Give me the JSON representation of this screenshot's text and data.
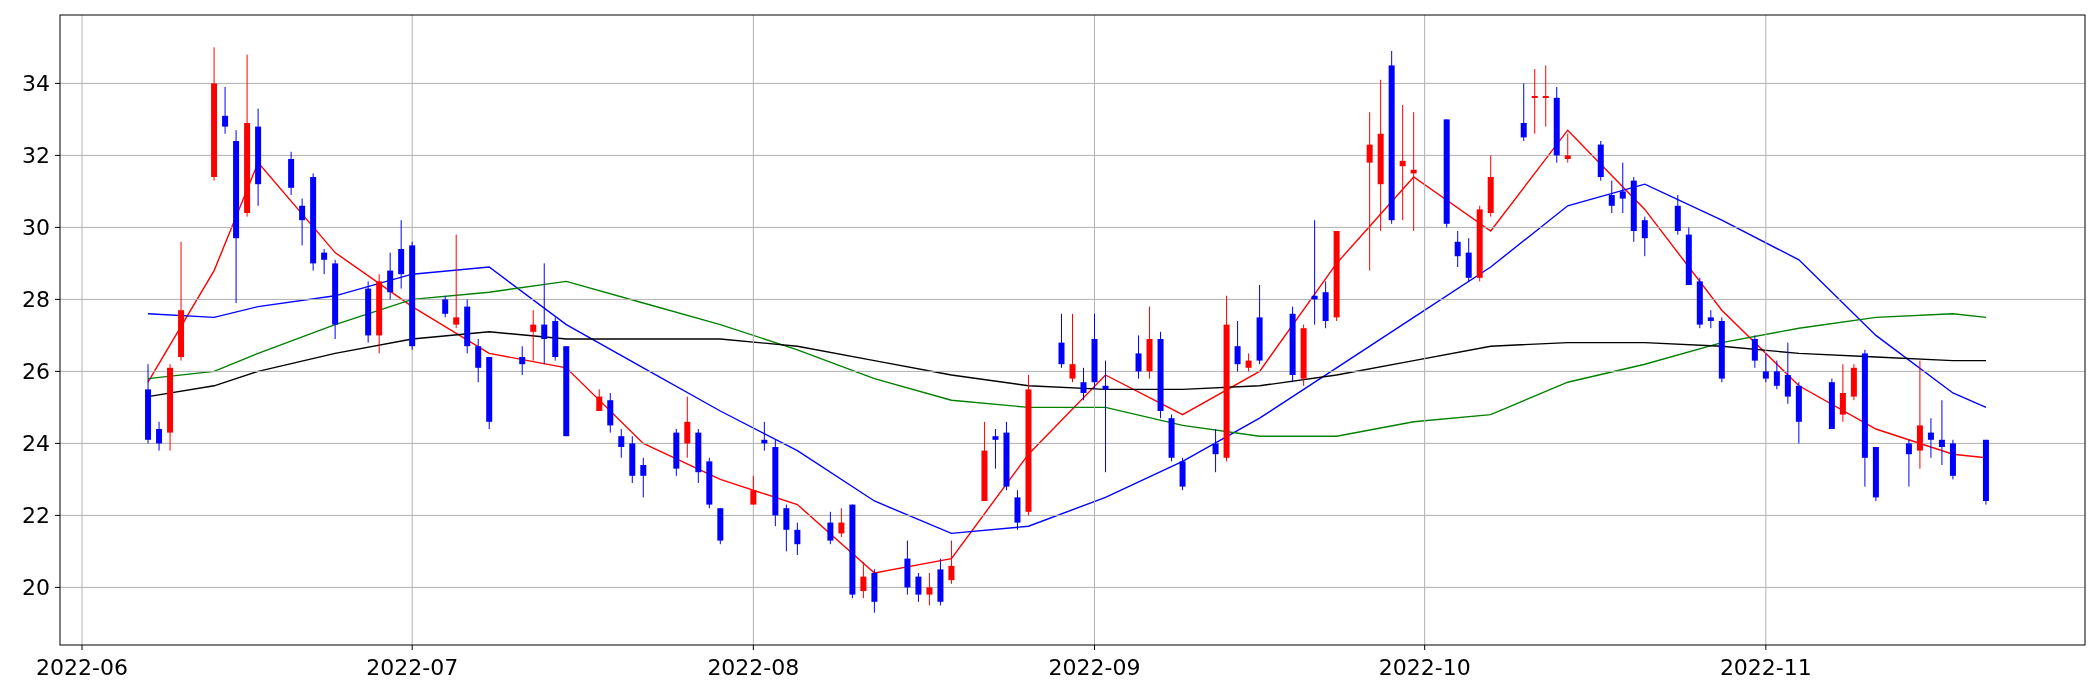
{
  "price_chart": {
    "chart_data": {
      "type": "candlestick",
      "grid": true,
      "xlim": [
        "2022-05-30",
        "2022-11-30"
      ],
      "ylim": [
        18.4,
        35.9
      ],
      "xticks": [
        {
          "value": "2022-06-01",
          "label": "2022-06"
        },
        {
          "value": "2022-07-01",
          "label": "2022-07"
        },
        {
          "value": "2022-08-01",
          "label": "2022-08"
        },
        {
          "value": "2022-09-01",
          "label": "2022-09"
        },
        {
          "value": "2022-10-01",
          "label": "2022-10"
        },
        {
          "value": "2022-11-01",
          "label": "2022-11"
        }
      ],
      "yticks": [
        20,
        22,
        24,
        26,
        28,
        30,
        32,
        34
      ],
      "x": [
        "2022-06-07",
        "2022-06-08",
        "2022-06-09",
        "2022-06-10",
        "2022-06-13",
        "2022-06-14",
        "2022-06-15",
        "2022-06-16",
        "2022-06-17",
        "2022-06-20",
        "2022-06-21",
        "2022-06-22",
        "2022-06-23",
        "2022-06-24",
        "2022-06-27",
        "2022-06-28",
        "2022-06-29",
        "2022-06-30",
        "2022-07-01",
        "2022-07-04",
        "2022-07-05",
        "2022-07-06",
        "2022-07-07",
        "2022-07-08",
        "2022-07-11",
        "2022-07-12",
        "2022-07-13",
        "2022-07-14",
        "2022-07-15",
        "2022-07-18",
        "2022-07-19",
        "2022-07-20",
        "2022-07-21",
        "2022-07-22",
        "2022-07-25",
        "2022-07-26",
        "2022-07-27",
        "2022-07-28",
        "2022-07-29",
        "2022-08-01",
        "2022-08-02",
        "2022-08-03",
        "2022-08-04",
        "2022-08-05",
        "2022-08-08",
        "2022-08-09",
        "2022-08-10",
        "2022-08-11",
        "2022-08-12",
        "2022-08-15",
        "2022-08-16",
        "2022-08-17",
        "2022-08-18",
        "2022-08-19",
        "2022-08-22",
        "2022-08-23",
        "2022-08-24",
        "2022-08-25",
        "2022-08-26",
        "2022-08-29",
        "2022-08-30",
        "2022-08-31",
        "2022-09-01",
        "2022-09-02",
        "2022-09-05",
        "2022-09-06",
        "2022-09-07",
        "2022-09-08",
        "2022-09-09",
        "2022-09-12",
        "2022-09-13",
        "2022-09-14",
        "2022-09-15",
        "2022-09-16",
        "2022-09-19",
        "2022-09-20",
        "2022-09-21",
        "2022-09-22",
        "2022-09-23",
        "2022-09-26",
        "2022-09-27",
        "2022-09-28",
        "2022-09-29",
        "2022-09-30",
        "2022-10-03",
        "2022-10-04",
        "2022-10-05",
        "2022-10-06",
        "2022-10-07",
        "2022-10-10",
        "2022-10-11",
        "2022-10-12",
        "2022-10-13",
        "2022-10-14",
        "2022-10-17",
        "2022-10-18",
        "2022-10-19",
        "2022-10-20",
        "2022-10-21",
        "2022-10-24",
        "2022-10-25",
        "2022-10-26",
        "2022-10-27",
        "2022-10-28",
        "2022-10-31",
        "2022-11-01",
        "2022-11-02",
        "2022-11-03",
        "2022-11-04",
        "2022-11-07",
        "2022-11-08",
        "2022-11-09",
        "2022-11-10",
        "2022-11-11",
        "2022-11-14",
        "2022-11-15",
        "2022-11-16",
        "2022-11-17",
        "2022-11-18",
        "2022-11-21"
      ],
      "ohlc": [
        [
          25.5,
          26.2,
          24.0,
          24.1
        ],
        [
          24.4,
          24.6,
          23.8,
          24.0
        ],
        [
          24.3,
          26.2,
          23.8,
          26.1
        ],
        [
          26.4,
          29.6,
          26.3,
          27.7
        ],
        [
          31.4,
          35.0,
          31.3,
          34.0
        ],
        [
          33.1,
          33.9,
          32.6,
          32.8
        ],
        [
          32.4,
          32.7,
          27.9,
          29.7
        ],
        [
          30.4,
          34.8,
          30.3,
          32.9
        ],
        [
          32.8,
          33.3,
          30.6,
          31.2
        ],
        [
          31.9,
          32.1,
          30.9,
          31.1
        ],
        [
          30.6,
          30.8,
          29.5,
          30.2
        ],
        [
          31.4,
          31.5,
          28.8,
          29.0
        ],
        [
          29.3,
          29.4,
          28.7,
          29.1
        ],
        [
          29.0,
          29.1,
          26.9,
          27.3
        ],
        [
          28.3,
          28.5,
          26.8,
          27.0
        ],
        [
          27.0,
          28.7,
          26.5,
          28.5
        ],
        [
          28.8,
          29.3,
          28.0,
          28.2
        ],
        [
          29.4,
          30.2,
          28.3,
          28.7
        ],
        [
          29.5,
          29.6,
          26.6,
          26.7
        ],
        [
          28.0,
          28.1,
          27.5,
          27.6
        ],
        [
          27.3,
          29.8,
          27.2,
          27.5
        ],
        [
          27.8,
          28.0,
          26.5,
          26.7
        ],
        [
          26.7,
          26.9,
          25.7,
          26.1
        ],
        [
          26.4,
          26.4,
          24.4,
          24.6
        ],
        [
          26.4,
          26.7,
          25.9,
          26.2
        ],
        [
          27.1,
          27.7,
          26.3,
          27.3
        ],
        [
          27.3,
          29.0,
          26.2,
          26.9
        ],
        [
          27.4,
          27.5,
          26.3,
          26.4
        ],
        [
          26.7,
          26.7,
          24.2,
          24.2
        ],
        [
          24.9,
          25.5,
          24.9,
          25.3
        ],
        [
          25.2,
          25.4,
          24.3,
          24.5
        ],
        [
          24.2,
          24.4,
          23.6,
          23.9
        ],
        [
          24.0,
          24.2,
          22.9,
          23.1
        ],
        [
          23.4,
          23.6,
          22.5,
          23.1
        ],
        [
          24.3,
          24.4,
          23.1,
          23.3
        ],
        [
          24.0,
          25.3,
          23.6,
          24.6
        ],
        [
          24.3,
          24.4,
          22.9,
          23.2
        ],
        [
          23.5,
          23.6,
          22.2,
          22.3
        ],
        [
          22.2,
          22.2,
          21.2,
          21.3
        ],
        [
          22.3,
          23.1,
          22.3,
          22.7
        ],
        [
          24.1,
          24.6,
          23.8,
          24.0
        ],
        [
          23.9,
          24.1,
          21.7,
          22.0
        ],
        [
          22.2,
          22.3,
          21.0,
          21.6
        ],
        [
          21.6,
          21.8,
          20.9,
          21.2
        ],
        [
          21.8,
          22.1,
          21.2,
          21.3
        ],
        [
          21.5,
          22.2,
          21.4,
          21.8
        ],
        [
          22.3,
          22.3,
          19.7,
          19.8
        ],
        [
          19.9,
          20.7,
          19.7,
          20.3
        ],
        [
          20.4,
          20.5,
          19.3,
          19.6
        ],
        [
          20.8,
          21.3,
          19.8,
          20.0
        ],
        [
          20.3,
          20.4,
          19.6,
          19.8
        ],
        [
          19.8,
          20.4,
          19.5,
          20.0
        ],
        [
          20.5,
          20.8,
          19.5,
          19.6
        ],
        [
          20.2,
          21.3,
          20.1,
          20.6
        ],
        [
          22.4,
          24.6,
          22.4,
          23.8
        ],
        [
          24.2,
          24.4,
          23.3,
          24.1
        ],
        [
          24.3,
          24.6,
          22.7,
          22.8
        ],
        [
          22.5,
          22.7,
          21.6,
          21.8
        ],
        [
          22.1,
          25.9,
          22.0,
          25.5
        ],
        [
          26.8,
          27.6,
          26.1,
          26.2
        ],
        [
          25.8,
          27.6,
          25.7,
          26.2
        ],
        [
          25.7,
          26.1,
          25.2,
          25.4
        ],
        [
          26.9,
          27.6,
          25.5,
          25.7
        ],
        [
          25.6,
          26.3,
          23.2,
          25.5
        ],
        [
          26.5,
          27.0,
          25.8,
          26.0
        ],
        [
          26.0,
          27.8,
          25.8,
          26.9
        ],
        [
          26.9,
          27.1,
          24.7,
          24.9
        ],
        [
          24.7,
          24.8,
          23.5,
          23.6
        ],
        [
          23.5,
          23.6,
          22.7,
          22.8
        ],
        [
          24.0,
          24.4,
          23.2,
          23.7
        ],
        [
          23.6,
          28.1,
          23.5,
          27.3
        ],
        [
          26.7,
          27.4,
          26.0,
          26.2
        ],
        [
          26.1,
          26.5,
          26.0,
          26.3
        ],
        [
          27.5,
          28.4,
          26.2,
          26.3
        ],
        [
          27.6,
          27.8,
          25.7,
          25.9
        ],
        [
          25.8,
          27.3,
          25.6,
          27.2
        ],
        [
          28.1,
          30.2,
          27.3,
          28.0
        ],
        [
          28.2,
          28.5,
          27.2,
          27.4
        ],
        [
          27.5,
          29.9,
          27.4,
          29.9
        ],
        [
          31.8,
          33.2,
          28.8,
          32.3
        ],
        [
          31.2,
          34.1,
          29.9,
          32.6
        ],
        [
          34.5,
          34.9,
          30.1,
          30.2
        ],
        [
          31.7,
          33.4,
          30.2,
          31.85
        ],
        [
          31.5,
          33.2,
          29.9,
          31.6
        ],
        [
          33.0,
          33.0,
          30.0,
          30.1
        ],
        [
          29.6,
          29.9,
          28.9,
          29.2
        ],
        [
          29.3,
          29.7,
          28.5,
          28.6
        ],
        [
          28.6,
          30.6,
          28.5,
          30.5
        ],
        [
          30.4,
          32.0,
          30.3,
          31.4
        ],
        [
          32.9,
          34.0,
          32.4,
          32.5
        ],
        [
          33.6,
          34.4,
          32.6,
          33.65
        ],
        [
          33.6,
          34.5,
          32.8,
          33.65
        ],
        [
          33.6,
          33.9,
          31.8,
          32.0
        ],
        [
          31.9,
          32.6,
          31.8,
          32.0
        ],
        [
          32.3,
          32.4,
          31.3,
          31.4
        ],
        [
          30.9,
          31.3,
          30.4,
          30.6
        ],
        [
          31.0,
          31.8,
          30.4,
          30.8
        ],
        [
          31.3,
          31.4,
          29.6,
          29.9
        ],
        [
          30.2,
          30.3,
          29.2,
          29.7
        ],
        [
          30.6,
          30.9,
          29.8,
          29.9
        ],
        [
          29.8,
          30.0,
          28.4,
          28.4
        ],
        [
          28.5,
          28.6,
          27.2,
          27.3
        ],
        [
          27.5,
          27.7,
          27.2,
          27.4
        ],
        [
          27.4,
          27.5,
          25.7,
          25.8
        ],
        [
          26.9,
          27.0,
          26.1,
          26.3
        ],
        [
          26.0,
          26.5,
          25.7,
          25.8
        ],
        [
          26.0,
          26.3,
          25.5,
          25.6
        ],
        [
          25.9,
          26.8,
          25.1,
          25.3
        ],
        [
          25.6,
          25.7,
          24.0,
          24.6
        ],
        [
          25.7,
          25.8,
          24.4,
          24.4
        ],
        [
          24.8,
          26.2,
          24.6,
          25.4
        ],
        [
          25.3,
          26.2,
          25.2,
          26.1
        ],
        [
          26.5,
          26.6,
          22.8,
          23.6
        ],
        [
          23.9,
          23.9,
          22.4,
          22.5
        ],
        [
          24.0,
          24.1,
          22.8,
          23.7
        ],
        [
          23.8,
          26.3,
          23.3,
          24.5
        ],
        [
          24.3,
          24.7,
          23.6,
          24.1
        ],
        [
          24.1,
          25.2,
          23.4,
          23.9
        ],
        [
          24.0,
          24.1,
          23.0,
          23.1
        ],
        [
          24.1,
          24.1,
          22.3,
          22.4
        ]
      ]
    }
  },
  "moving_averages": {
    "chart_data": {
      "type": "line",
      "xlim": [
        "2022-05-30",
        "2022-11-30"
      ],
      "ylim": [
        18.4,
        35.9
      ],
      "x": [
        "2022-06-07",
        "2022-06-13",
        "2022-06-17",
        "2022-06-24",
        "2022-07-01",
        "2022-07-08",
        "2022-07-15",
        "2022-07-22",
        "2022-07-29",
        "2022-08-05",
        "2022-08-12",
        "2022-08-19",
        "2022-08-26",
        "2022-09-02",
        "2022-09-09",
        "2022-09-16",
        "2022-09-23",
        "2022-09-30",
        "2022-10-07",
        "2022-10-14",
        "2022-10-21",
        "2022-10-28",
        "2022-11-04",
        "2022-11-11",
        "2022-11-18",
        "2022-11-21"
      ],
      "series": [
        {
          "color": "#ff0000",
          "values": [
            25.7,
            28.8,
            31.8,
            29.3,
            27.8,
            26.5,
            26.1,
            24.0,
            23.0,
            22.3,
            20.4,
            20.8,
            23.7,
            25.9,
            24.8,
            26.0,
            29.0,
            31.4,
            29.9,
            32.7,
            30.5,
            27.7,
            25.6,
            24.4,
            23.7,
            23.6
          ]
        },
        {
          "color": "#0000ff",
          "values": [
            27.6,
            27.5,
            27.8,
            28.1,
            28.7,
            28.9,
            27.3,
            26.1,
            24.9,
            23.8,
            22.4,
            21.5,
            21.7,
            22.5,
            23.5,
            24.7,
            26.1,
            27.5,
            28.9,
            30.6,
            31.2,
            30.2,
            29.1,
            27.0,
            25.4,
            25.0
          ]
        },
        {
          "color": "#008000",
          "values": [
            25.8,
            26.0,
            26.5,
            27.3,
            28.0,
            28.2,
            28.5,
            27.9,
            27.3,
            26.6,
            25.8,
            25.2,
            25.0,
            25.0,
            24.5,
            24.2,
            24.2,
            24.6,
            24.8,
            25.7,
            26.2,
            26.8,
            27.2,
            27.5,
            27.6,
            27.5
          ]
        },
        {
          "color": "#000000",
          "values": [
            25.3,
            25.6,
            26.0,
            26.5,
            26.9,
            27.1,
            26.9,
            26.9,
            26.9,
            26.7,
            26.3,
            25.9,
            25.6,
            25.5,
            25.5,
            25.6,
            25.9,
            26.3,
            26.7,
            26.8,
            26.8,
            26.7,
            26.5,
            26.4,
            26.3,
            26.3
          ]
        }
      ]
    }
  }
}
